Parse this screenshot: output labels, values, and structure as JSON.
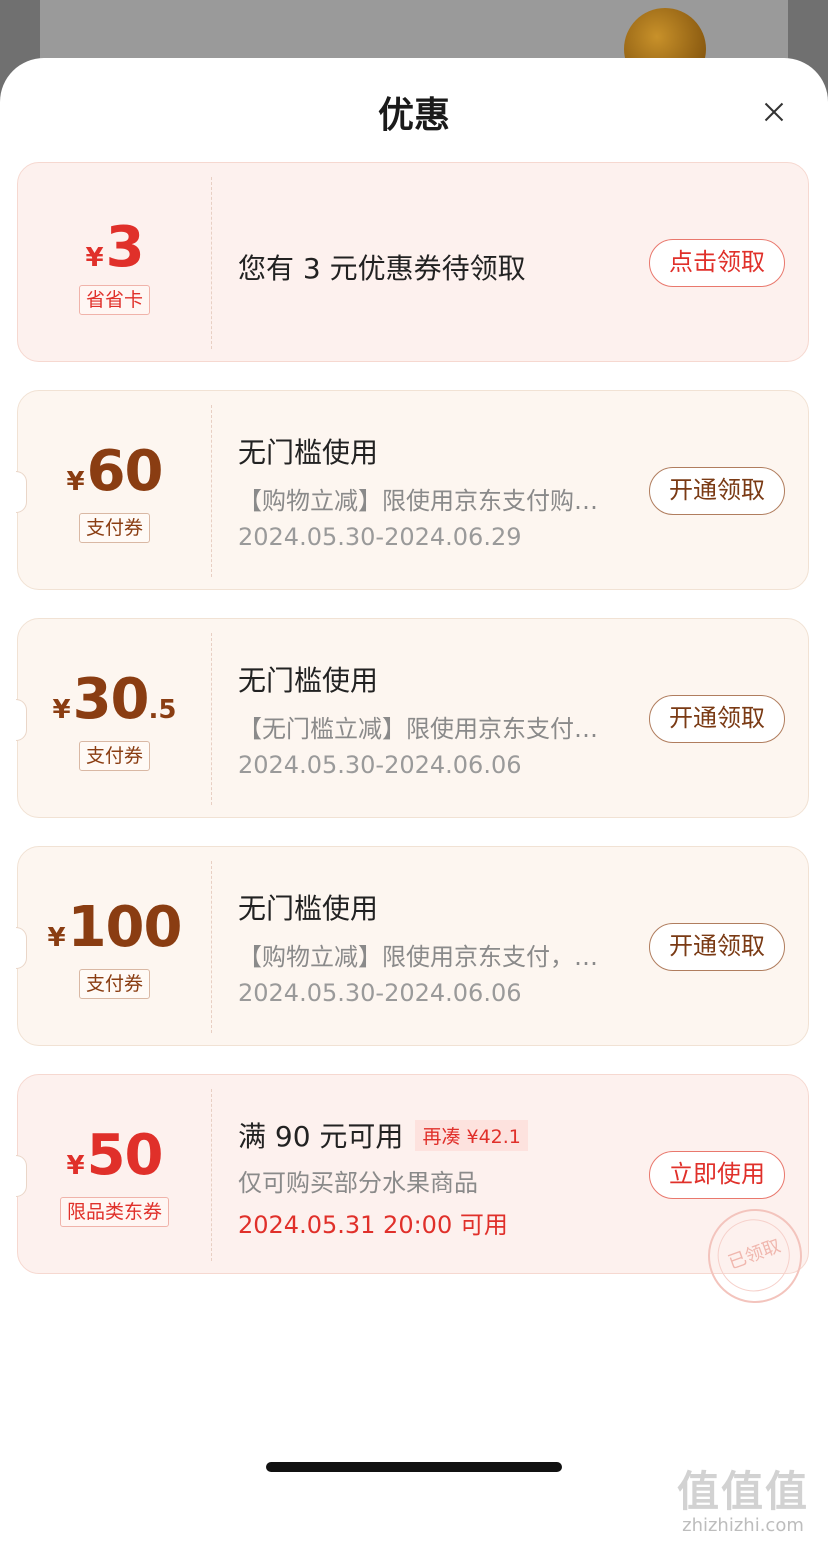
{
  "sheet": {
    "title": "优惠"
  },
  "coupons": [
    {
      "currency": "¥",
      "amount_int": "3",
      "amount_dec": "",
      "tag": "省省卡",
      "title": "您有 3 元优惠券待领取",
      "button": "点击领取"
    },
    {
      "currency": "¥",
      "amount_int": "60",
      "amount_dec": "",
      "tag": "支付券",
      "title": "无门槛使用",
      "desc": "【购物立减】限使用京东支付购…",
      "date": "2024.05.30-2024.06.29",
      "button": "开通领取"
    },
    {
      "currency": "¥",
      "amount_int": "30",
      "amount_dec": ".5",
      "tag": "支付券",
      "title": "无门槛使用",
      "desc": "【无门槛立减】限使用京东支付…",
      "date": "2024.05.30-2024.06.06",
      "button": "开通领取"
    },
    {
      "currency": "¥",
      "amount_int": "100",
      "amount_dec": "",
      "tag": "支付券",
      "title": "无门槛使用",
      "desc": "【购物立减】限使用京东支付，…",
      "date": "2024.05.30-2024.06.06",
      "button": "开通领取"
    },
    {
      "currency": "¥",
      "amount_int": "50",
      "amount_dec": "",
      "tag": "限品类东券",
      "title": "满 90 元可用",
      "pill": "再凑 ¥42.1",
      "desc": "仅可购买部分水果商品",
      "date": "2024.05.31 20:00 可用",
      "button": "立即使用",
      "stamp": "已领取"
    }
  ],
  "watermark": {
    "logo": "值值值",
    "site": "zhizhizhi.com"
  },
  "colors": {
    "accent_red": "#e0302a",
    "accent_brown": "#8a3d12"
  }
}
